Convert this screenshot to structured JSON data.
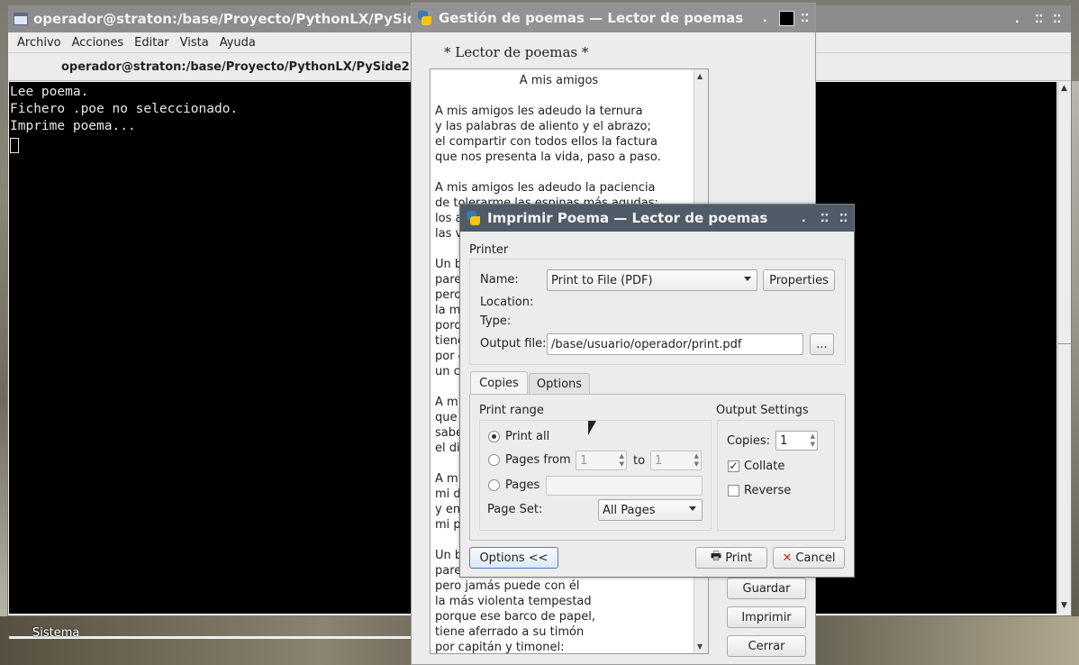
{
  "desktop": {
    "system_label": "Sistema"
  },
  "terminal": {
    "title": "operador@straton:/base/Proyecto/PythonLX/PySide2",
    "menu": [
      "Archivo",
      "Acciones",
      "Editar",
      "Vista",
      "Ayuda"
    ],
    "tab_title": "operador@straton:/base/Proyecto/PythonLX/PySide2",
    "lines": [
      "Lee poema.",
      "Fichero .poe no seleccionado.",
      "Imprime poema..."
    ]
  },
  "poem_window": {
    "title": "Gestión de poemas — Lector de poemas",
    "heading": "* Lector de poemas *",
    "poem_title": "A mis amigos",
    "stanza1": [
      "A mis amigos les adeudo la ternura",
      "y las palabras de aliento y el abrazo;",
      "el compartir con todos ellos la factura",
      "que nos presenta la vida, paso a paso."
    ],
    "stanza2": [
      "A mis amigos les adeudo la paciencia",
      "de tolerarme las espinas más agudas;",
      "los a",
      "las v"
    ],
    "stanza3": [
      "Un b",
      "pare",
      "pero",
      "la m",
      "porq",
      "tiene",
      "por c",
      "un c"
    ],
    "stanza4": [
      "A mi",
      "que",
      "sabe",
      "el di"
    ],
    "stanza5": [
      "A mi",
      "mi d",
      "y en",
      "mi p"
    ],
    "stanza6": [
      "Un b",
      "pare",
      "pero jamás puede con él",
      "la más violenta tempestad",
      "porque ese barco de papel,",
      "tiene aferrado a su timón",
      "por capitán y timonel:"
    ],
    "buttons": {
      "save": "Guardar",
      "print": "Imprimir",
      "close": "Cerrar"
    }
  },
  "print_dialog": {
    "title": "Imprimir Poema — Lector de poemas",
    "printer_group": "Printer",
    "name_label": "Name:",
    "printer_name": "Print to File (PDF)",
    "properties_button": "Properties",
    "location_label": "Location:",
    "type_label": "Type:",
    "output_file_label": "Output file:",
    "output_file": "/base/usuario/operador/print.pdf",
    "browse_button": "...",
    "tabs": [
      "Copies",
      "Options"
    ],
    "print_range_label": "Print range",
    "print_all": "Print all",
    "pages_from": "Pages from",
    "from_value": "1",
    "to_label": "to",
    "to_value": "1",
    "pages": "Pages",
    "page_set_label": "Page Set:",
    "page_set": "All Pages",
    "output_settings_label": "Output Settings",
    "copies_label": "Copies:",
    "copies_value": "1",
    "collate": "Collate",
    "reverse": "Reverse",
    "options_button": "Options <<",
    "print_button": "Print",
    "cancel_button": "Cancel"
  }
}
